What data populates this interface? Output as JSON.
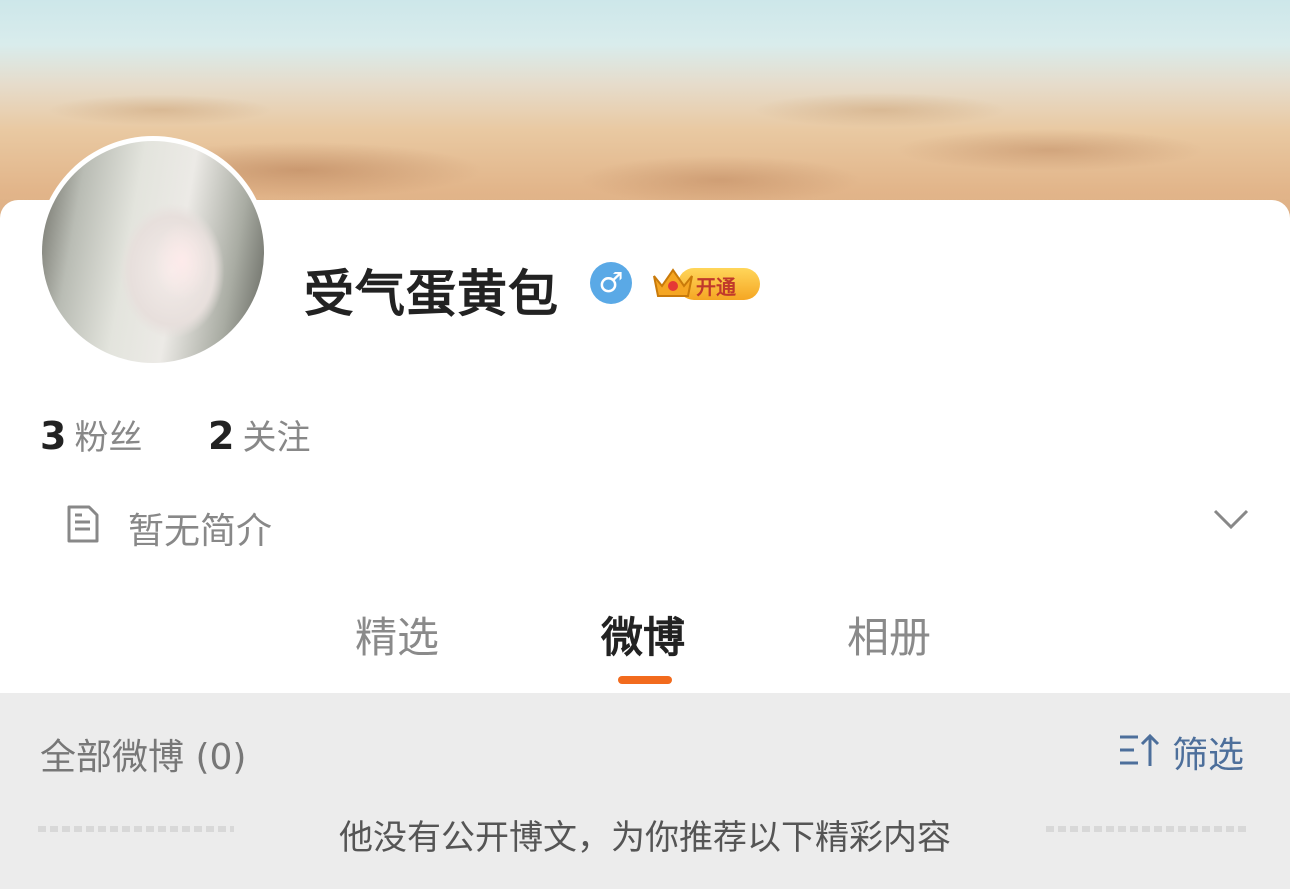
{
  "profile": {
    "name": "受气蛋黄包",
    "gender_symbol": "♂",
    "vip_label": "开通",
    "followers_count": "3",
    "followers_label": "粉丝",
    "following_count": "2",
    "following_label": "关注",
    "bio": "暂无简介"
  },
  "tabs": [
    {
      "label": "精选",
      "active": false
    },
    {
      "label": "微博",
      "active": true
    },
    {
      "label": "相册",
      "active": false
    }
  ],
  "feed": {
    "title": "全部微博 (0)",
    "filter_label": "筛选",
    "empty_message": "他没有公开博文，为你推荐以下精彩内容"
  },
  "colors": {
    "accent": "#f26b1d",
    "link": "#4d6f9b",
    "gender_badge": "#5aa9e6",
    "vip_gold": "#f5a623"
  },
  "icons": {
    "bio": "document-icon",
    "expand": "chevron-down-icon",
    "filter": "sort-filter-icon",
    "vip": "crown-icon"
  }
}
